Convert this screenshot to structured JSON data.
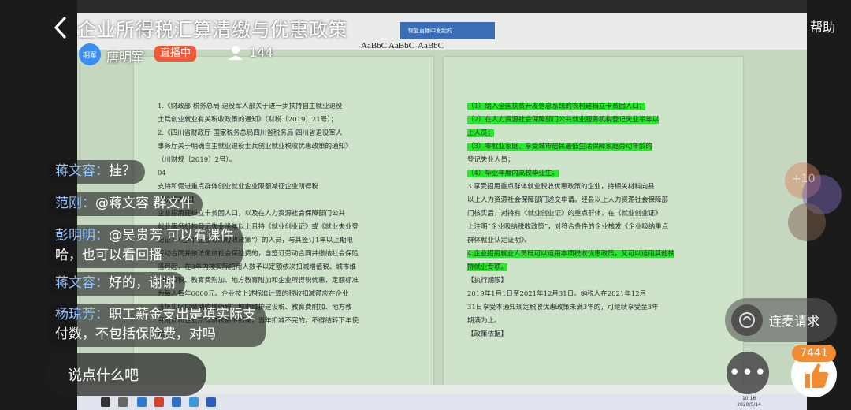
{
  "header": {
    "title": "企业所得税汇算清缴与优惠政策",
    "help": "帮助",
    "host_avatar": "明军",
    "host_name": "唐明军",
    "live_badge": "直播中",
    "viewer_count": "144"
  },
  "screen": {
    "ribbon_styles": [
      "AaBbC",
      "AaBbC",
      "AaBbC"
    ],
    "ribbon_tip": "恢复直播中发起的",
    "left_page_lines": [
      {
        "text": "1.《财政部 税务总局 退役军人部关于进一步扶持自主就业退役",
        "hl": false
      },
      {
        "text": "士兵创业就业有关税收政策的通知》（财税〔2019〕21号）；",
        "hl": false
      },
      {
        "text": "2.《四川省财政厅 国家税务总局四川省税务局 四川省退役军人",
        "hl": false
      },
      {
        "text": "事务厅关于明确自主就业退役士兵创业就业税收优惠政策的通知》",
        "hl": false
      },
      {
        "text": "（川财规〔2019〕2号）。",
        "hl": false
      },
      {
        "text": "04",
        "hl": false
      },
      {
        "text": "支持和促进重点群体创业就业企业限额减征企业所得税",
        "hl": false
      },
      {
        "text": "【优惠内容】",
        "hl": false
      },
      {
        "text": "企业招用建档立卡贫困人口，以及在人力资源社会保障部门公共",
        "hl": false
      },
      {
        "text": "就业服务机构登记失业半年以上且持《就业创业证》或《就业失业登",
        "hl": false
      },
      {
        "text": "记证》（注明“企业吸纳税收政策”）的人员，与其签订1年以上期限",
        "hl": false
      },
      {
        "text": "劳动合同并依法缴纳社会保险费的，自签订劳动合同并缴纳社会保险",
        "hl": false
      },
      {
        "text": "当月起，在3年内按实际招用人数予以定额依次扣减增值税、城市维",
        "hl": false
      },
      {
        "text": "护建设税、教育费附加、地方教育附加和企业所得税优惠，定额标准",
        "hl": false
      },
      {
        "text": "为每人每年6000元。企业按上述标准计算的税收扣减额应在企业",
        "hl": false
      },
      {
        "text": "当年实际应缴纳的增值税、城市维护建设税、教育费附加、地方教",
        "hl": false
      },
      {
        "text": "育附加和企业所得税税额中扣减，当年扣减不完的，不得结转下年使",
        "hl": false
      },
      {
        "text": "用。",
        "hl": false
      }
    ],
    "right_page_lines": [
      {
        "text": "（1）纳入全国扶贫开发信息系统的农村建档立卡贫困人口；",
        "hl": true
      },
      {
        "text": "（2）在人力资源社会保障部门公共就业服务机构登记失业半年以",
        "hl": true
      },
      {
        "text": "上人员；",
        "hl": true
      },
      {
        "text": "（3）零就业家庭、享受城市居民最低生活保障家庭劳动年龄的",
        "hl": true
      },
      {
        "text": "登记失业人员；",
        "hl": false
      },
      {
        "text": "（4）毕业年度内高校毕业生。",
        "hl": true
      },
      {
        "text": "3.享受招用重点群体就业税收优惠政策的企业，持相关材料向县",
        "hl": false
      },
      {
        "text": "以上人力资源社会保障部门递交申请。经县以上人力资源社会保障部",
        "hl": false
      },
      {
        "text": "门核实后，对持有《就业创业证》的重点群体，在《就业创业证》",
        "hl": false
      },
      {
        "text": "上注明“企业吸纳税收政策”，对符合条件的企业核发《企业吸纳重点",
        "hl": false
      },
      {
        "text": "群体就业认定证明》。",
        "hl": false
      },
      {
        "text": "4.企业招用就业人员既可以适用本项税收优惠政策，又可以适用其他扶",
        "hl": true
      },
      {
        "text": "持就业专项。",
        "hl": true
      },
      {
        "text": "【执行期限】",
        "hl": false
      },
      {
        "text": "2019年1月1日至2021年12月31日。纳税人在2021年12月",
        "hl": false
      },
      {
        "text": "31日享受本通知规定税收优惠政策未满3年的，可继续享受至3年",
        "hl": false
      },
      {
        "text": "期满为止。",
        "hl": false
      },
      {
        "text": "【政策依据】",
        "hl": false
      }
    ],
    "clock_time": "10:16",
    "clock_date": "2020/5/14"
  },
  "chat": [
    {
      "name": "蒋文容：",
      "text": "挂？"
    },
    {
      "name": "范刚：",
      "text": "@蒋文容 群文件"
    },
    {
      "name": "彭明明：",
      "text": "@吴贵芳 可以看课件",
      "text2": "哈，也可以看回播"
    },
    {
      "name": "蒋文容：",
      "text": "好的，谢谢"
    },
    {
      "name": "杨琼芳：",
      "text": "职工薪金支出是填实际支",
      "text2": "付数，不包括保险费，对吗"
    }
  ],
  "controls": {
    "comment_placeholder": "说点什么吧",
    "mic_label": "连麦请求",
    "more_label": "•••",
    "like_count": "7441",
    "floating_plus": "+10"
  },
  "colors": {
    "live_badge": "#ee5a3a",
    "chat_name": "#8fc2ff",
    "like_badge": "#f28c32",
    "highlight": "#27e62b"
  }
}
